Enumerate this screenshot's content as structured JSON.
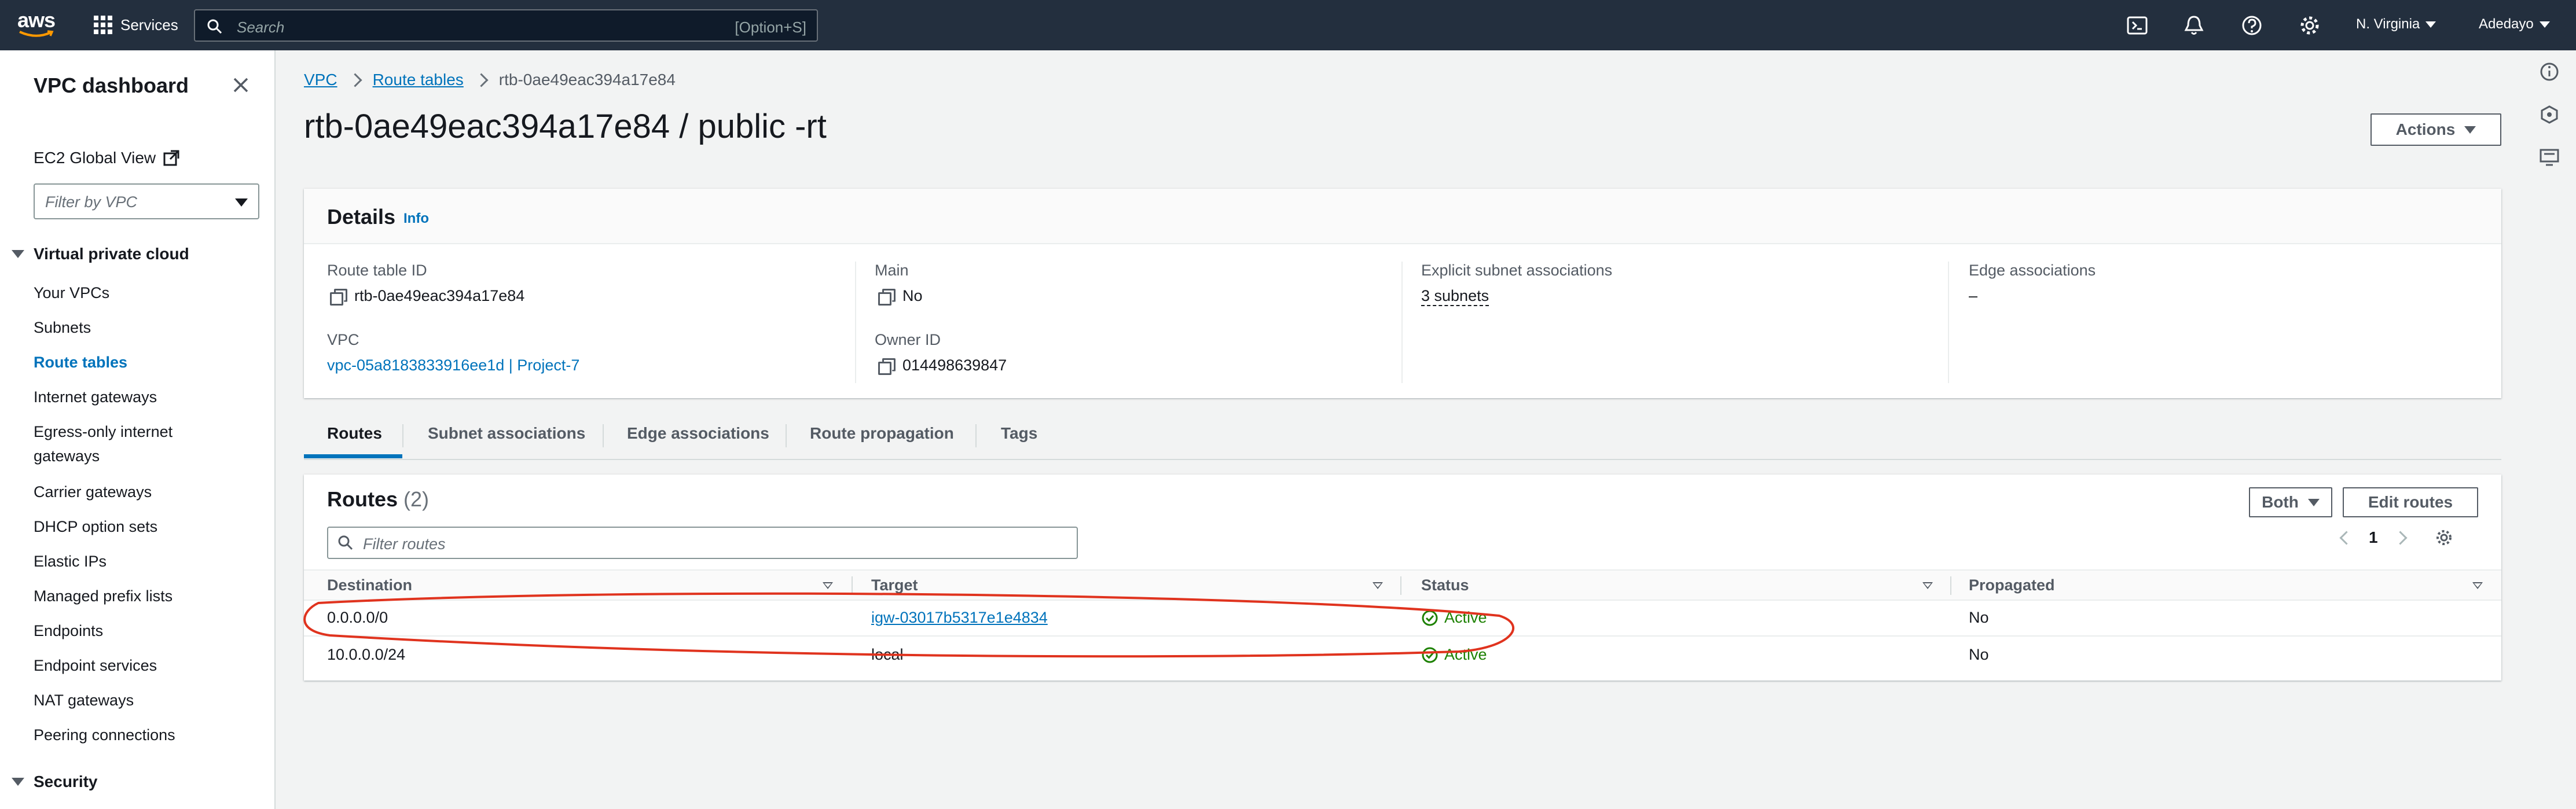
{
  "topnav": {
    "logo_text": "aws",
    "services_label": "Services",
    "search_placeholder": "Search",
    "search_shortcut": "[Option+S]",
    "region": "N. Virginia",
    "user": "Adedayo",
    "icons": [
      "cloudshell-icon",
      "bell-icon",
      "help-icon",
      "gear-icon"
    ]
  },
  "sidebar": {
    "title": "VPC dashboard",
    "global_view": "EC2 Global View",
    "filter_placeholder": "Filter by VPC",
    "section_vpc": "Virtual private cloud",
    "items": [
      "Your VPCs",
      "Subnets",
      "Route tables",
      "Internet gateways",
      "Egress-only internet gateways",
      "Carrier gateways",
      "DHCP option sets",
      "Elastic IPs",
      "Managed prefix lists",
      "Endpoints",
      "Endpoint services",
      "NAT gateways",
      "Peering connections"
    ],
    "active_item": "Route tables",
    "section_security": "Security"
  },
  "breadcrumb": {
    "items": [
      "VPC",
      "Route tables"
    ],
    "current": "rtb-0ae49eac394a17e84"
  },
  "page_title": "rtb-0ae49eac394a17e84 / public -rt",
  "actions_label": "Actions",
  "details": {
    "title": "Details",
    "info": "Info",
    "route_table_id_label": "Route table ID",
    "route_table_id": "rtb-0ae49eac394a17e84",
    "vpc_label": "VPC",
    "vpc_value": "vpc-05a8183833916ee1d | Project-7",
    "main_label": "Main",
    "main_value": "No",
    "owner_label": "Owner ID",
    "owner_value": "014498639847",
    "explicit_label": "Explicit subnet associations",
    "explicit_value": "3 subnets",
    "edge_label": "Edge associations",
    "edge_value": "–"
  },
  "tabs": [
    "Routes",
    "Subnet associations",
    "Edge associations",
    "Route propagation",
    "Tags"
  ],
  "active_tab": "Routes",
  "routes": {
    "title": "Routes",
    "count": "(2)",
    "both_label": "Both",
    "edit_label": "Edit routes",
    "filter_placeholder": "Filter routes",
    "page": "1",
    "columns": [
      "Destination",
      "Target",
      "Status",
      "Propagated"
    ],
    "rows": [
      {
        "destination": "0.0.0.0/0",
        "target": "igw-03017b5317e1e4834",
        "status": "Active",
        "propagated": "No"
      },
      {
        "destination": "10.0.0.0/24",
        "target": "local",
        "status": "Active",
        "propagated": "No"
      }
    ]
  },
  "colors": {
    "nav_bg": "#232f3e",
    "link": "#0073bb",
    "success": "#1d8102",
    "annotation": "#e0331e"
  }
}
